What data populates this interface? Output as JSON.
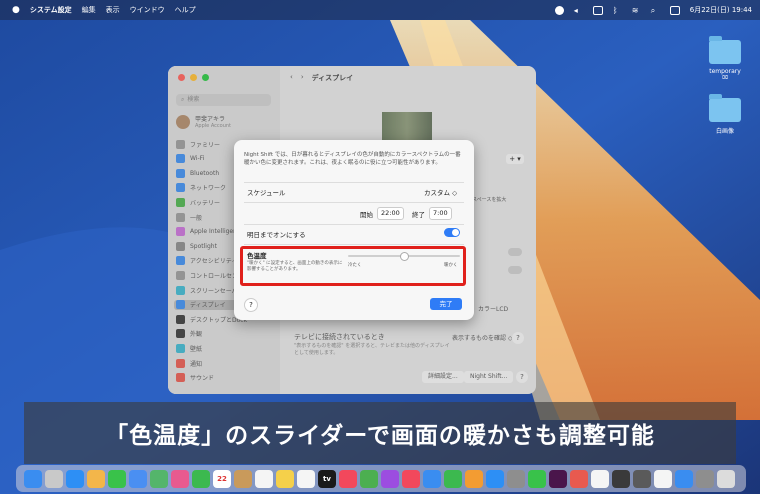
{
  "menubar": {
    "apple": "",
    "app_name": "システム設定",
    "items": [
      "編集",
      "表示",
      "ウインドウ",
      "ヘルプ"
    ],
    "datetime": "6月22日(日) 19:44"
  },
  "desktop": {
    "icons": [
      {
        "label": "temporary",
        "sub": "⌧"
      },
      {
        "label": "白画像",
        "sub": ""
      }
    ]
  },
  "sidebar": {
    "search_placeholder": "検索",
    "user_name": "甲斐アキラ",
    "user_sub": "Apple Account",
    "items": [
      {
        "label": "ファミリー",
        "color": "#9a9a9a"
      },
      {
        "label": "Wi-Fi",
        "color": "#3d8ef0"
      },
      {
        "label": "Bluetooth",
        "color": "#3d8ef0"
      },
      {
        "label": "ネットワーク",
        "color": "#3d8ef0"
      },
      {
        "label": "バッテリー",
        "color": "#4cb34c"
      },
      {
        "label": "一般",
        "color": "#9a9a9a"
      },
      {
        "label": "Apple Intelligence",
        "color": "#c96fd8"
      },
      {
        "label": "Spotlight",
        "color": "#8a8a8a"
      },
      {
        "label": "アクセシビリティ",
        "color": "#3d8ef0"
      },
      {
        "label": "コントロールセンター",
        "color": "#9a9a9a"
      },
      {
        "label": "スクリーンセーバ",
        "color": "#3db8d0"
      },
      {
        "label": "ディスプレイ",
        "color": "#3d8ef0"
      },
      {
        "label": "デスクトップとDock",
        "color": "#3a3a3a"
      },
      {
        "label": "外観",
        "color": "#3a3a3a"
      },
      {
        "label": "壁紙",
        "color": "#3db8d0"
      },
      {
        "label": "通知",
        "color": "#e85a4f"
      },
      {
        "label": "サウンド",
        "color": "#e85a4f"
      }
    ]
  },
  "main": {
    "title": "ディスプレイ",
    "plus": "+ ▾",
    "space_label": "スペースを拡大",
    "color_label": "カラーLCD",
    "tv_title": "テレビに接続されているとき",
    "tv_desc": "\"表示するものを確認\" を選択すると、テレビまたは他のディスプレイとして使用します。",
    "tv_select": "表示するものを確認 ◇",
    "advanced_btn": "詳細設定...",
    "nightshift_btn": "Night Shift...",
    "help": "?"
  },
  "night_shift": {
    "description": "Night Shift では、日が暮れるとディスプレイの色が自動的にカラースペクトラムの一番暖かい色に変更されます。これは、夜よく眠るのに役に立つ可能性があります。",
    "schedule_label": "スケジュール",
    "schedule_value": "カスタム ◇",
    "start_label": "開始",
    "start_time": "22:00",
    "end_label": "終了",
    "end_time": "7:00",
    "until_tomorrow_label": "明日までオンにする",
    "color_temp_label": "色温度",
    "color_temp_note": "\"暖かく\" に設定すると、画面上の動きの表示に影響することがあります。",
    "less_warm": "冷たく",
    "more_warm": "暖かく",
    "slider_value": 0.5,
    "help": "?",
    "done": "完了"
  },
  "caption": "「色温度」のスライダーで画面の暖かさも調整可能",
  "dock": {
    "apps": [
      {
        "name": "finder",
        "color": "#3a8df0"
      },
      {
        "name": "launchpad",
        "color": "#c9c9c9"
      },
      {
        "name": "safari",
        "color": "#2d8ff5"
      },
      {
        "name": "photos",
        "color": "#f3b64a"
      },
      {
        "name": "messages",
        "color": "#39c24a"
      },
      {
        "name": "mail",
        "color": "#4a8ff2"
      },
      {
        "name": "maps",
        "color": "#54b56b"
      },
      {
        "name": "photos2",
        "color": "#e85a8f"
      },
      {
        "name": "facetime",
        "color": "#3cb94f"
      },
      {
        "name": "calendar",
        "color": "#ffffff",
        "label": "22"
      },
      {
        "name": "contacts",
        "color": "#c99a5b"
      },
      {
        "name": "reminders",
        "color": "#f5f5f5"
      },
      {
        "name": "notes",
        "color": "#f5d04a"
      },
      {
        "name": "freeform",
        "color": "#f5f5f5"
      },
      {
        "name": "appletv",
        "color": "#1a1a1a",
        "label": "tv"
      },
      {
        "name": "music",
        "color": "#f2485c"
      },
      {
        "name": "chrome",
        "color": "#4caf50"
      },
      {
        "name": "podcasts",
        "color": "#9c4de0"
      },
      {
        "name": "news",
        "color": "#f2485c"
      },
      {
        "name": "keynote",
        "color": "#3a8df0"
      },
      {
        "name": "numbers",
        "color": "#3cb94f"
      },
      {
        "name": "pages",
        "color": "#f39c32"
      },
      {
        "name": "appstore",
        "color": "#2d8ff5"
      },
      {
        "name": "settings",
        "color": "#8e8e8e"
      },
      {
        "name": "line",
        "color": "#39c24a"
      },
      {
        "name": "slack",
        "color": "#4a154b"
      },
      {
        "name": "app27",
        "color": "#e85a4f"
      },
      {
        "name": "app28",
        "color": "#f5f5f5"
      },
      {
        "name": "app29",
        "color": "#3a3a3a"
      },
      {
        "name": "app30",
        "color": "#5a5a5a"
      },
      {
        "name": "app31",
        "color": "#f5f5f5"
      },
      {
        "name": "app32",
        "color": "#3a8df0"
      },
      {
        "name": "app33",
        "color": "#8e8e8e"
      },
      {
        "name": "trash",
        "color": "#dcdcdc"
      }
    ]
  }
}
